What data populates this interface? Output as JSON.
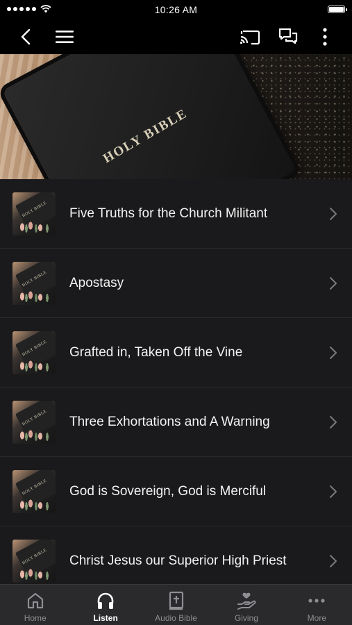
{
  "status_bar": {
    "time": "10:26 AM"
  },
  "nav": {
    "back_icon": "chevron-left-icon",
    "menu_icon": "hamburger-menu-icon",
    "cast_icon": "cast-icon",
    "chat_icon": "chat-bubbles-icon",
    "more_icon": "vertical-dots-icon"
  },
  "hero": {
    "book_title": "HOLY BIBLE"
  },
  "thumbnail_text": "HOLY BIBLE",
  "sermons": [
    {
      "title": "Five Truths for the Church Militant"
    },
    {
      "title": "Apostasy"
    },
    {
      "title": "Grafted in, Taken Off the Vine"
    },
    {
      "title": "Three Exhortations and A Warning"
    },
    {
      "title": "God is Sovereign, God is Merciful"
    },
    {
      "title": "Christ Jesus our Superior High Priest"
    }
  ],
  "tabs": [
    {
      "label": "Home",
      "icon": "home-icon",
      "active": false
    },
    {
      "label": "Listen",
      "icon": "headphones-icon",
      "active": true
    },
    {
      "label": "Audio Bible",
      "icon": "bible-icon",
      "active": false
    },
    {
      "label": "Giving",
      "icon": "giving-hand-icon",
      "active": false
    },
    {
      "label": "More",
      "icon": "more-dots-icon",
      "active": false
    }
  ],
  "colors": {
    "background": "#1a1a1c",
    "bar": "#000000",
    "tab_bar": "#2a2a2c",
    "tab_inactive": "#8e8e93",
    "tab_active": "#ffffff"
  }
}
